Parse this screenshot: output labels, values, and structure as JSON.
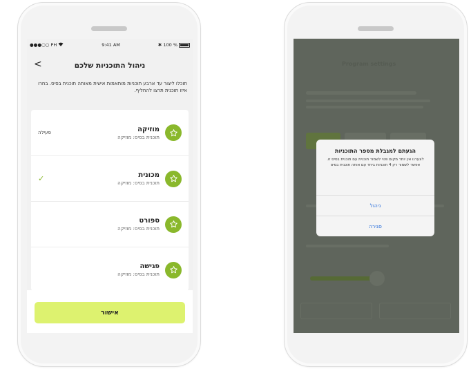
{
  "left_phone": {
    "status": {
      "carrier": "●●●○○ PH",
      "time": "9:41 AM",
      "battery": "100 %"
    },
    "header": {
      "title": "ניהול התוכניות שלכם",
      "back_glyph": "<"
    },
    "description": "תוכלו ליצור עד ארבע תוכניות מותאמות אישית מאותה תוכנית בסיס. בחרו איזו תוכנית תרצו להחליף.",
    "programs": [
      {
        "name": "מוזיקה",
        "base": "תוכנית בסיס: מוזיקה",
        "status": "פעילה",
        "selected": false
      },
      {
        "name": "מכונית",
        "base": "תוכנית בסיס: מוזיקה",
        "status": "",
        "selected": true
      },
      {
        "name": "ספורט",
        "base": "תוכנית בסיס: מוזיקה",
        "status": "",
        "selected": false
      },
      {
        "name": "פגישה",
        "base": "תוכנית בסיס: מוזיקה",
        "status": "",
        "selected": false
      }
    ],
    "confirm_label": "אישור",
    "check_glyph": "✓",
    "accent": "#8ab82c",
    "button_color": "#ddf26f"
  },
  "right_phone": {
    "dialog": {
      "title": "הגעתם למגבלת מספר התוכניות",
      "body": "לצערנו אין יותר מקום פנוי לשמור תוכנית עם תוכנית בסיס זו. אפשר לשמור רק 4 תוכניות ביחד עם אותה תוכנית בסיס",
      "manage_label": "ניהול",
      "close_label": "סגירה"
    },
    "background_title": "Program settings",
    "link_color": "#2a6fdb"
  }
}
